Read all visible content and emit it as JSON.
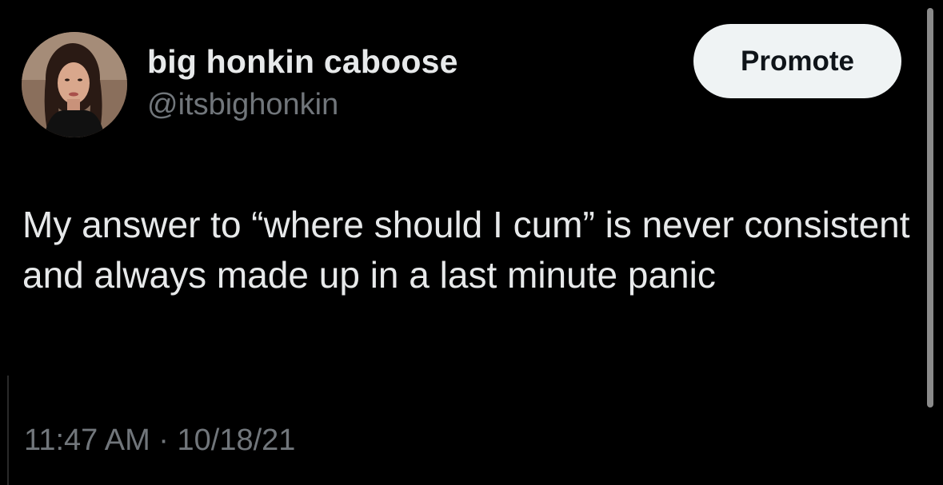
{
  "user": {
    "display_name": "big honkin caboose",
    "handle": "@itsbighonkin"
  },
  "actions": {
    "promote_label": "Promote"
  },
  "tweet": {
    "text": "My answer to “where should I cum” is never consistent and always made up in a last minute panic",
    "timestamp": "11:47 AM · 10/18/21"
  },
  "colors": {
    "background": "#000000",
    "primary_text": "#e7e9ea",
    "secondary_text": "#71767b",
    "button_bg": "#eff3f4",
    "button_text": "#0f1419"
  }
}
